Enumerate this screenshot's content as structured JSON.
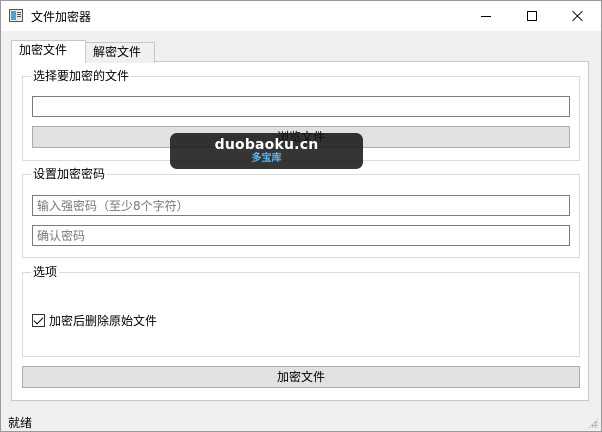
{
  "window": {
    "title": "文件加密器"
  },
  "tabs": [
    {
      "label": "加密文件",
      "active": true
    },
    {
      "label": "解密文件",
      "active": false
    }
  ],
  "file_group": {
    "title": "选择要加密的文件",
    "path_value": "",
    "browse_label": "浏览文件"
  },
  "password_group": {
    "title": "设置加密密码",
    "password_placeholder": "输入强密码（至少8个字符）",
    "confirm_placeholder": "确认密码"
  },
  "options_group": {
    "title": "选项",
    "delete_original_label": "加密后删除原始文件",
    "delete_original_checked": true
  },
  "encrypt_button_label": "加密文件",
  "status": "就绪",
  "watermark": {
    "main": "duobaoku.cn",
    "sub": "多宝库"
  }
}
